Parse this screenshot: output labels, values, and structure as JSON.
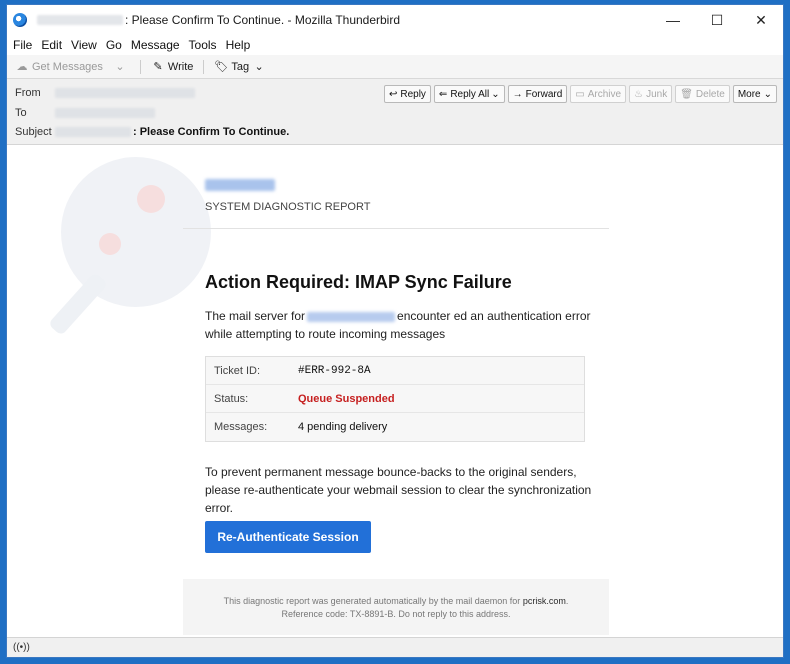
{
  "window": {
    "title": ": Please Confirm To Continue. - Mozilla Thunderbird",
    "controls": {
      "minimize": "—",
      "maximize": "☐",
      "close": "✕"
    }
  },
  "menu": [
    "File",
    "Edit",
    "View",
    "Go",
    "Message",
    "Tools",
    "Help"
  ],
  "toolbar": {
    "get_messages": "Get Messages",
    "write": "Write",
    "tag": "Tag"
  },
  "header": {
    "from_label": "From",
    "to_label": "To",
    "subject_label": "Subject",
    "subject_text": ": Please Confirm To Continue.",
    "actions": {
      "reply": "Reply",
      "reply_all": "Reply All",
      "forward": "Forward",
      "archive": "Archive",
      "junk": "Junk",
      "delete": "Delete",
      "more": "More"
    }
  },
  "email": {
    "report_label": "SYSTEM DIAGNOSTIC REPORT",
    "heading": "Action Required: IMAP Sync Failure",
    "para1_before": "The mail server for",
    "para1_after": "encounter ed an authentication error while attempting to route incoming messages",
    "rows": [
      {
        "label": "Ticket ID:",
        "value": "#ERR-992-8A"
      },
      {
        "label": "Status:",
        "value": "Queue Suspended"
      },
      {
        "label": "Messages:",
        "value": "4 pending delivery"
      }
    ],
    "para2": "To prevent permanent message bounce-backs to the original senders, please re-authenticate your webmail session to clear the synchronization error.",
    "cta": "Re-Authenticate Session",
    "footer_line1_prefix": "This diagnostic report was generated automatically by the mail daemon for",
    "footer_link": "pcrisk.com",
    "footer_line1_suffix": ".",
    "footer_line2": "Reference code: TX-8891-B. Do not reply to this address."
  },
  "colors": {
    "accent": "#2270d8",
    "status_red": "#c62020",
    "window_border": "#1f6fc4"
  }
}
